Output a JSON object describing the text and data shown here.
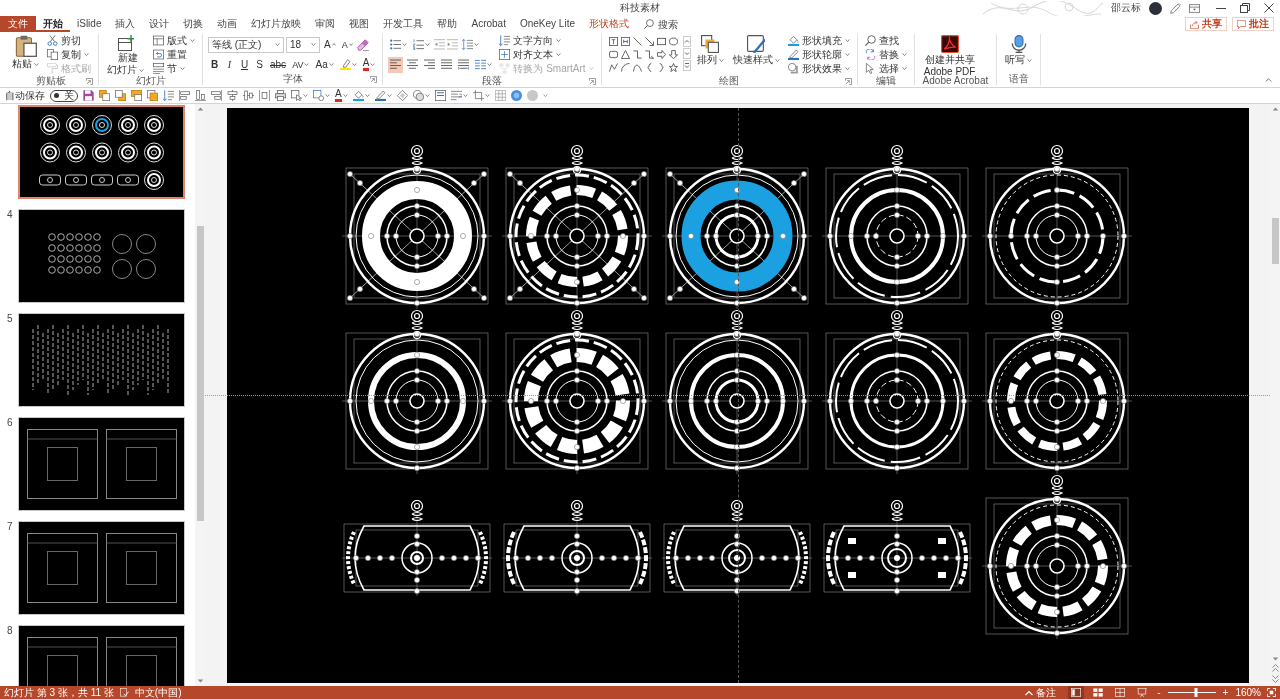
{
  "window": {
    "title": "科技素材",
    "user": "邵云标"
  },
  "tabs": [
    {
      "label": "文件",
      "kind": "file",
      "selected": false
    },
    {
      "label": "开始",
      "kind": "normal",
      "selected": true
    },
    {
      "label": "iSlide",
      "kind": "normal",
      "selected": false
    },
    {
      "label": "插入",
      "kind": "normal",
      "selected": false
    },
    {
      "label": "设计",
      "kind": "normal",
      "selected": false
    },
    {
      "label": "切换",
      "kind": "normal",
      "selected": false
    },
    {
      "label": "动画",
      "kind": "normal",
      "selected": false
    },
    {
      "label": "幻灯片放映",
      "kind": "normal",
      "selected": false
    },
    {
      "label": "审阅",
      "kind": "normal",
      "selected": false
    },
    {
      "label": "视图",
      "kind": "normal",
      "selected": false
    },
    {
      "label": "开发工具",
      "kind": "normal",
      "selected": false
    },
    {
      "label": "帮助",
      "kind": "normal",
      "selected": false
    },
    {
      "label": "Acrobat",
      "kind": "normal",
      "selected": false
    },
    {
      "label": "OneKey Lite",
      "kind": "normal",
      "selected": false
    },
    {
      "label": "形状格式",
      "kind": "contextual",
      "selected": false
    }
  ],
  "search": {
    "placeholder": "搜索"
  },
  "actions": [
    {
      "label": "共享",
      "kind": "share"
    },
    {
      "label": "批注",
      "kind": "comment"
    }
  ],
  "ribbon": {
    "groups": [
      {
        "kind": "clipboard",
        "label": "剪贴板",
        "launcher": true,
        "buttons": [
          {
            "label": "粘贴",
            "menu": true,
            "disabled": false
          },
          {
            "label": "剪切",
            "menu": false,
            "disabled": false
          },
          {
            "label": "复制",
            "menu": true,
            "disabled": false
          },
          {
            "label": "格式刷",
            "menu": false,
            "disabled": true
          }
        ]
      },
      {
        "kind": "slides",
        "label": "幻灯片",
        "launcher": false,
        "buttons": [
          {
            "label": "新建幻灯片",
            "menu": true
          },
          {
            "label": "版式",
            "menu": true
          },
          {
            "label": "重置",
            "menu": false
          },
          {
            "label": "节",
            "menu": true
          }
        ]
      },
      {
        "kind": "font",
        "label": "字体",
        "launcher": true,
        "font_name": "等线 (正文)",
        "font_size": "18",
        "grow": "A",
        "shrink": "A",
        "bold": "B",
        "italic": "I",
        "underline": "U",
        "shadow": "S",
        "strikethrough": "abc",
        "spacing": "AV",
        "change_case": "Aa",
        "font_color": "A"
      },
      {
        "kind": "paragraph",
        "label": "段落",
        "launcher": true,
        "alignments": [
          {
            "kind": "left",
            "selected": true
          },
          {
            "kind": "center",
            "selected": false
          },
          {
            "kind": "right",
            "selected": false
          },
          {
            "kind": "justify",
            "selected": false
          },
          {
            "kind": "distributed",
            "selected": false
          }
        ],
        "buttons": [
          {
            "label": "文字方向",
            "menu": true,
            "disabled": false
          },
          {
            "label": "对齐文本",
            "menu": true,
            "disabled": false
          },
          {
            "label": "转换为 SmartArt",
            "menu": true,
            "disabled": true
          }
        ]
      },
      {
        "kind": "drawing",
        "label": "绘图",
        "launcher": true,
        "buttons": [
          {
            "label": "排列",
            "menu": true
          },
          {
            "label": "快速样式",
            "menu": true
          },
          {
            "label": "形状填充",
            "menu": true
          },
          {
            "label": "形状轮廓",
            "menu": true
          },
          {
            "label": "形状效果",
            "menu": true
          }
        ]
      },
      {
        "kind": "editing",
        "label": "编辑",
        "launcher": false,
        "buttons": [
          {
            "label": "查找",
            "menu": false
          },
          {
            "label": "替换",
            "menu": true
          },
          {
            "label": "选择",
            "menu": true
          }
        ]
      },
      {
        "kind": "acrobat",
        "label": "Adobe Acrobat",
        "launcher": false,
        "buttons": [
          {
            "label": "创建并共享 Adobe PDF",
            "menu": false
          }
        ]
      },
      {
        "kind": "voice",
        "label": "语音",
        "launcher": false,
        "buttons": [
          {
            "label": "听写",
            "menu": true
          }
        ]
      }
    ]
  },
  "quick_access": {
    "autosave_label": "自动保存",
    "autosave": {
      "on": false,
      "label": "关"
    },
    "font_color": "A"
  },
  "thumbnails": [
    {
      "kind": "rings",
      "selected": true
    },
    {
      "number": "4",
      "kind": "dots",
      "selected": false
    },
    {
      "number": "5",
      "kind": "bars",
      "selected": false
    },
    {
      "number": "6",
      "kind": "frames",
      "selected": false
    },
    {
      "number": "7",
      "kind": "frames",
      "selected": false
    },
    {
      "number": "8",
      "kind": "frames",
      "selected": false
    }
  ],
  "slide": {
    "graphics": [
      {
        "kind": "round",
        "color": "#ffffff"
      },
      {
        "kind": "round",
        "color": "#ffffff"
      },
      {
        "kind": "round",
        "color": "#1ba1e2"
      },
      {
        "kind": "round",
        "color": "#ffffff"
      },
      {
        "kind": "round",
        "color": "#ffffff"
      },
      {
        "kind": "round",
        "color": "#ffffff"
      },
      {
        "kind": "round",
        "color": "#ffffff"
      },
      {
        "kind": "round",
        "color": "#ffffff"
      },
      {
        "kind": "round",
        "color": "#ffffff"
      },
      {
        "kind": "round",
        "color": "#ffffff"
      },
      {
        "kind": "wide",
        "color": "#ffffff"
      },
      {
        "kind": "wide",
        "color": "#ffffff"
      },
      {
        "kind": "wide",
        "color": "#ffffff"
      },
      {
        "kind": "wide",
        "color": "#ffffff"
      },
      {
        "kind": "round",
        "color": "#ffffff"
      }
    ]
  },
  "status_bar": {
    "slide_info": "幻灯片 第 3 张，共 11 张",
    "language": "中文(中国)",
    "notes": "备注",
    "views": [
      {
        "kind": "normal",
        "selected": true
      },
      {
        "kind": "sorter",
        "selected": false
      },
      {
        "kind": "reading",
        "selected": false
      },
      {
        "kind": "slideshow",
        "selected": false
      }
    ],
    "zoom_out": "-",
    "zoom_in": "+",
    "zoom": {
      "level": 0.6,
      "reading": "160%"
    }
  }
}
